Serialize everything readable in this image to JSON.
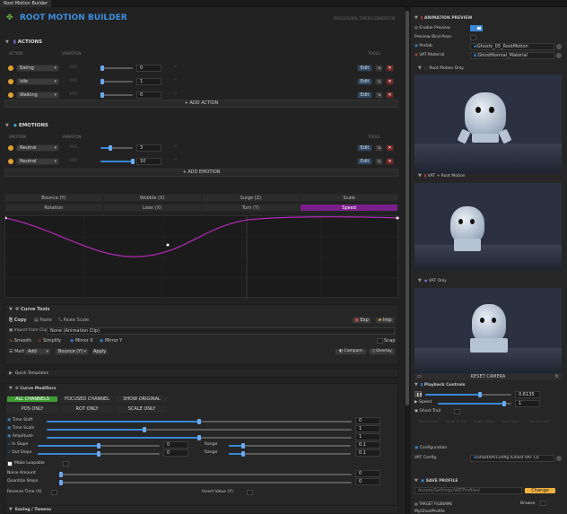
{
  "window": {
    "tab": "Root Motion Builder"
  },
  "header": {
    "title": "ROOT MOTION BUILDER",
    "subtitle": "PROCEDURAL TWEEN GENERATOR"
  },
  "actions": {
    "title": "ACTIONS",
    "col_action": "ACTION",
    "col_variation": "VARIATION",
    "col_tools": "TOOLS",
    "rows": [
      {
        "name": "Eating",
        "var": "VAR",
        "value": "0",
        "pct": 0.02
      },
      {
        "name": "Idle",
        "var": "VAR",
        "value": "1",
        "pct": 0.06
      },
      {
        "name": "Walking",
        "var": "VAR",
        "value": "0",
        "pct": 0.02
      }
    ],
    "edit_label": "Edit",
    "add_label": "ADD ACTION"
  },
  "emotions": {
    "title": "EMOTIONS",
    "col_emotion": "EMOTION",
    "col_variation": "VARIATION",
    "col_tools": "TOOLS",
    "rows": [
      {
        "name": "Neutral",
        "var": "VAR",
        "value": "3",
        "pct": 0.3
      },
      {
        "name": "Neutral",
        "var": "VAR",
        "value": "10",
        "pct": 1.0
      }
    ],
    "edit_label": "Edit",
    "add_label": "ADD EMOTION"
  },
  "curve_tabs": {
    "row1": [
      "Bounce (Y)",
      "Wobble (X)",
      "Surge (Z)",
      "Scale"
    ],
    "row2": [
      "Rotation",
      "Lean (X)",
      "Turn (Y)",
      "Speed"
    ],
    "active": "Speed"
  },
  "curve_tools": {
    "title": "Curve Tools",
    "copy": "Copy",
    "paste": "Paste",
    "paste_scale": "Paste Scale",
    "exp": "Exp",
    "imp": "Imp",
    "import_label": "Import from Clip",
    "import_value": "None (Animation Clip)",
    "smooth": "Smooth",
    "simplify": "Simplify",
    "mirror_x": "Mirror X",
    "mirror_y": "Mirror Y",
    "snap": "Snap",
    "math_label": "Math",
    "math_op": "Add",
    "math_target": "Bounce (Y)",
    "apply": "Apply",
    "compare": "Compare",
    "overlay": "Overlay"
  },
  "quick_templates": {
    "title": "Quick Templates"
  },
  "curve_modifiers": {
    "title": "Curve Modifiers",
    "all_channels": "ALL CHANNELS",
    "focused_channel": "FOCUSED CHANNEL",
    "show_original": "SHOW ORIGINAL",
    "pos_only": "POS ONLY",
    "rot_only": "ROT ONLY",
    "scale_only": "SCALE ONLY",
    "sliders": [
      {
        "label": "Time Shift",
        "value": "0",
        "pct": 0.5
      },
      {
        "label": "Time Scale",
        "value": "1",
        "pct": 0.32
      },
      {
        "label": "Amplitude",
        "value": "1",
        "pct": 0.5
      }
    ],
    "in_slope": {
      "label": "In Slope",
      "value": "0",
      "pct": 0.5
    },
    "out_slope": {
      "label": "Out Slope",
      "value": "0",
      "pct": 0.5
    },
    "range_label": "Range",
    "range1": "0.1",
    "range2": "0.1",
    "make_loopable": "Make Loopable",
    "noise_amount": {
      "label": "Noise Amount",
      "value": "0"
    },
    "quantize_steps": {
      "label": "Quantize Steps",
      "value": "0"
    },
    "reverse_time": "Reverse Time (X)",
    "invert_value": "Invert Value (Y)"
  },
  "easing": {
    "title": "Easing / Tweens"
  },
  "animation_preview": {
    "title": "ANIMATION PREVIEW",
    "enable_preview": "Enable Preview",
    "preview_bind_pose": "Preview Bind Pose",
    "prefab_label": "Prefab",
    "prefab_value": "Ghosts_05_RootMotion",
    "vat_material_label": "VAT Material",
    "vat_material_value": "GhostNormal_Material",
    "views": [
      "Root Motion Only",
      "VAT + Root Motion",
      "VAT Only"
    ],
    "reset_camera": "RESET CAMERA"
  },
  "playback": {
    "title": "Playback Controls",
    "time_value": "0.6135",
    "speed_label": "Speed",
    "speed_value": "1",
    "ghost_trail": "Ghost Trail",
    "faint_labels": [
      "Frame Count",
      "Width To Dist",
      "Bright Offset",
      "Scale Ratio",
      "Rotation Diff"
    ]
  },
  "configuration": {
    "title": "Configuration",
    "vat_config_label": "VAT Config",
    "vat_config_value": "GhostVATConfig (Ghost VAT Co"
  },
  "save_profile": {
    "title": "SAVE PROFILE",
    "path": "Assets/Settings/VATProfiles/",
    "change": "Change",
    "target_label": "TARGET FILENAME",
    "browse": "Browse",
    "filename": "MyGhostProfile"
  },
  "colors": {
    "accent": "#3c8fe0",
    "active_tab": "#7a1f8a",
    "curve": "#b02ab8",
    "green": "#3f9c35",
    "red": "#7a2323",
    "orange": "#f0b040"
  }
}
